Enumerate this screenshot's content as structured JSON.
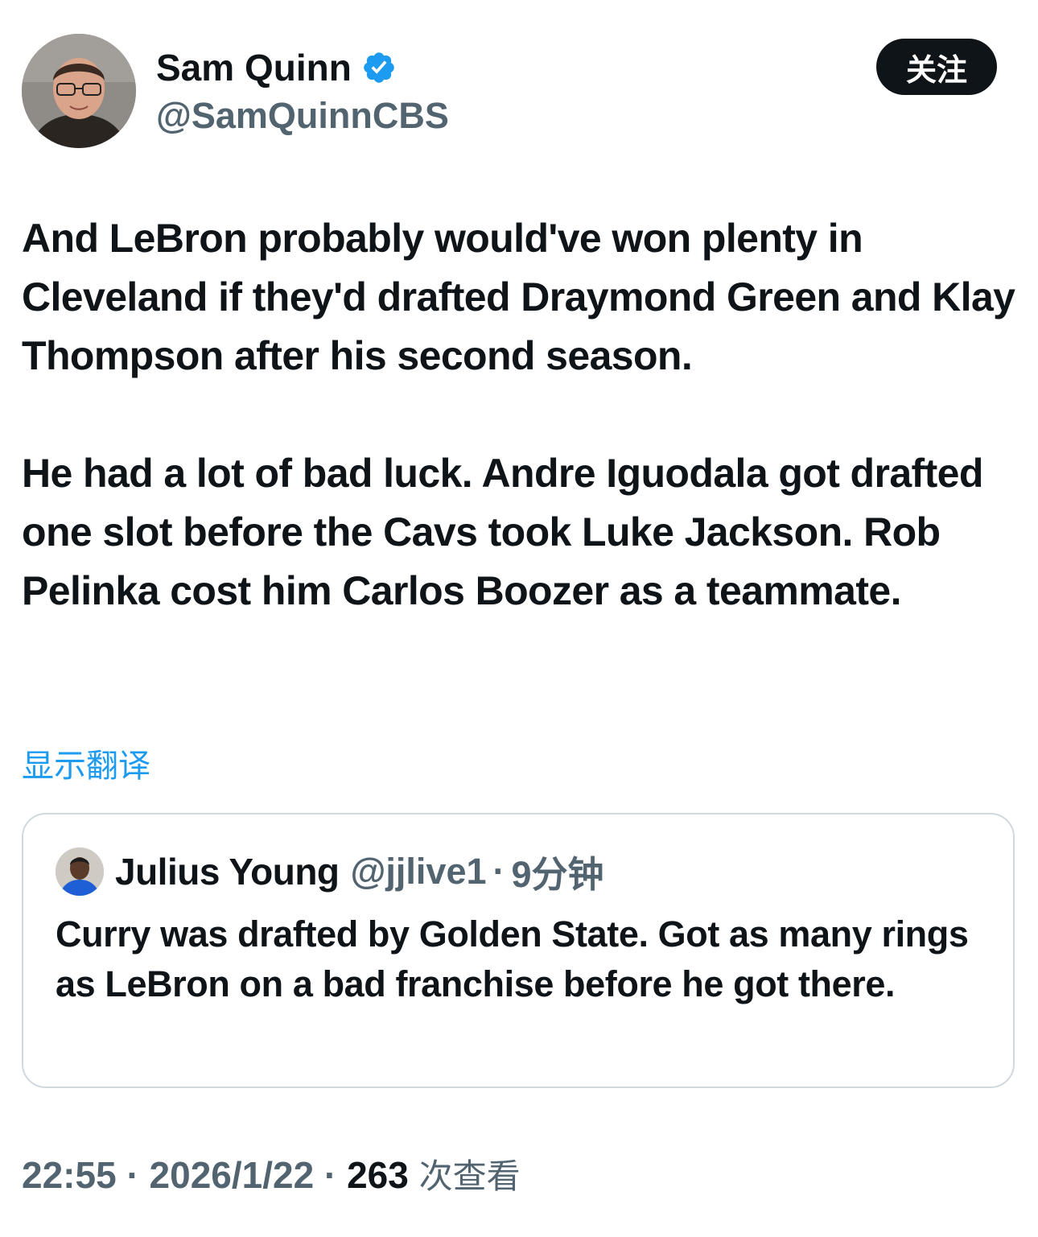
{
  "author": {
    "name": "Sam Quinn",
    "handle": "@SamQuinnCBS",
    "follow_label": "关注"
  },
  "tweet": {
    "paragraphs": [
      "And LeBron probably would've won plenty in Cleveland if they'd drafted Draymond Green and Klay Thompson after his second season.",
      "He had a lot of bad luck. Andre Iguodala got drafted one slot before the Cavs took Luke Jackson. Rob Pelinka cost him Carlos Boozer as a teammate."
    ],
    "translate_label": "显示翻译"
  },
  "quote": {
    "name": "Julius Young",
    "handle": "@jjlive1",
    "separator": "·",
    "time": "9分钟",
    "text": "Curry was drafted by Golden State.  Got as many rings as LeBron on a bad franchise before he got there."
  },
  "meta": {
    "time": "22:55",
    "separator": "·",
    "date": "2026/1/22",
    "views_count": "263",
    "views_label": "次查看"
  },
  "colors": {
    "verified_badge": "#1d9bf0",
    "link": "#1d9bf0",
    "secondary_text": "#536471",
    "primary_text": "#0f1419",
    "border": "#cfd9de"
  },
  "icons": {
    "verified": "verified-badge-icon"
  }
}
